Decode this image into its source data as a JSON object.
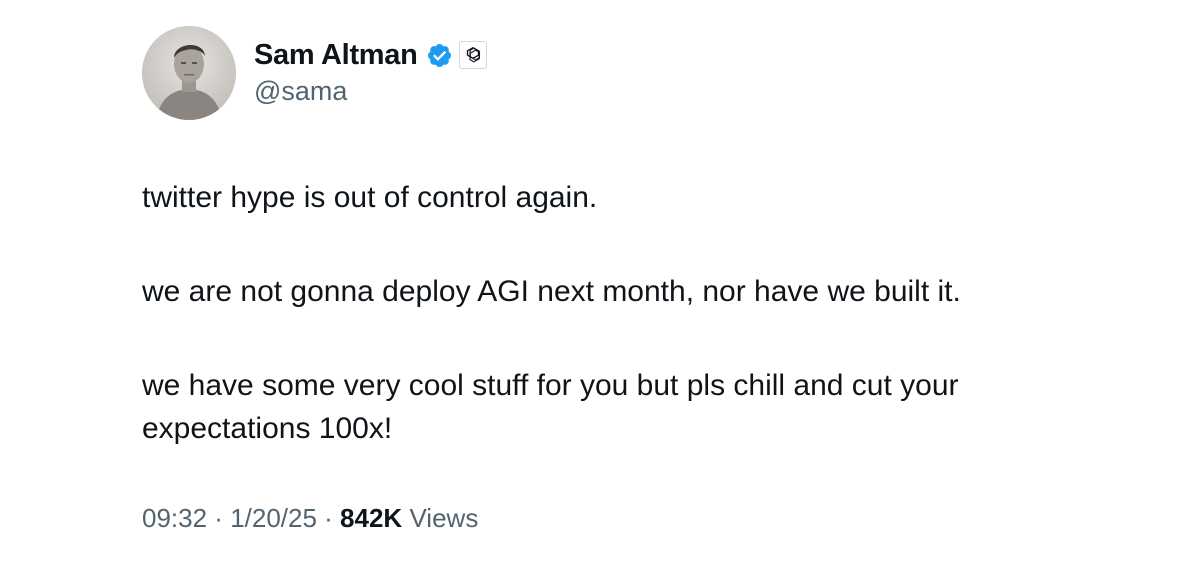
{
  "author": {
    "display_name": "Sam Altman",
    "handle": "@sama",
    "verified": true,
    "affiliate_badge": "openai-logo-icon",
    "verified_color": "#1d9bf0"
  },
  "tweet": {
    "paragraphs": [
      "twitter hype is out of control again.",
      "we are not gonna deploy AGI next month, nor have we built it.",
      "we have some very cool stuff for you but pls chill and cut your expectations 100x!"
    ]
  },
  "meta": {
    "time": "09:32",
    "separator": " · ",
    "date": "1/20/25",
    "views_count": "842K",
    "views_label": "Views"
  }
}
